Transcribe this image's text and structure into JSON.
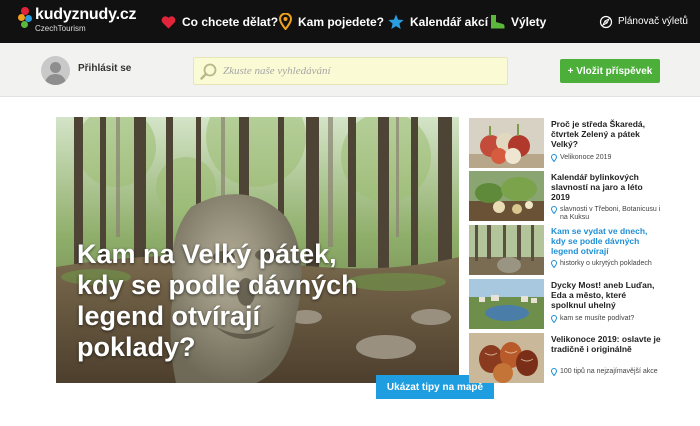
{
  "logo": {
    "name": "kudyznudy.cz",
    "sub": "CzechTourism"
  },
  "nav": [
    {
      "label": "Co chcete dělat?",
      "icon": "heart-icon",
      "color": "#e0243a"
    },
    {
      "label": "Kam pojedete?",
      "icon": "map-pin-icon",
      "color": "#f0a21c"
    },
    {
      "label": "Kalendář akcí",
      "icon": "star-icon",
      "color": "#2a9ee0"
    },
    {
      "label": "Výlety",
      "icon": "boot-icon",
      "color": "#5cb83c"
    }
  ],
  "planner": {
    "label": "Plánovač výletů",
    "icon": "compass-icon"
  },
  "user": {
    "login_label": "Přihlásit se"
  },
  "search": {
    "placeholder": "Zkuste naše vyhledávání"
  },
  "post_button": {
    "label": "+ Vložit příspěvek"
  },
  "hero": {
    "title": "Kam na Velký pátek, kdy se podle dávných legend otvírají poklady?",
    "map_button": "Ukázat tipy na mapě"
  },
  "side": [
    {
      "title": "Proč je středa Škaredá, čtvrtek Zelený a pátek Velký?",
      "tag": "Velikonoce 2019",
      "highlight": false
    },
    {
      "title": "Kalendář bylinkových slavností na jaro a léto 2019",
      "tag": "slavnosti v Třeboni, Botanicusu i na Kuksu",
      "highlight": false
    },
    {
      "title": "Kam se vydat ve dnech, kdy se podle dávných legend otvírají",
      "tag": "historky o ukrytých pokladech",
      "highlight": true
    },
    {
      "title": "Dycky Most! aneb Luďan, Eda a město, které spolknul uhelný",
      "tag": "kam se musíte podívat?",
      "highlight": false
    },
    {
      "title": "Velikonoce 2019: oslavte je tradičně i originálně",
      "tag": "100 tipů na nejzajímavější akce",
      "highlight": false
    }
  ],
  "colors": {
    "topbar": "#111111",
    "accent_green": "#4caf3a",
    "accent_blue": "#1e9de0",
    "pin_blue": "#1e8fd6"
  }
}
